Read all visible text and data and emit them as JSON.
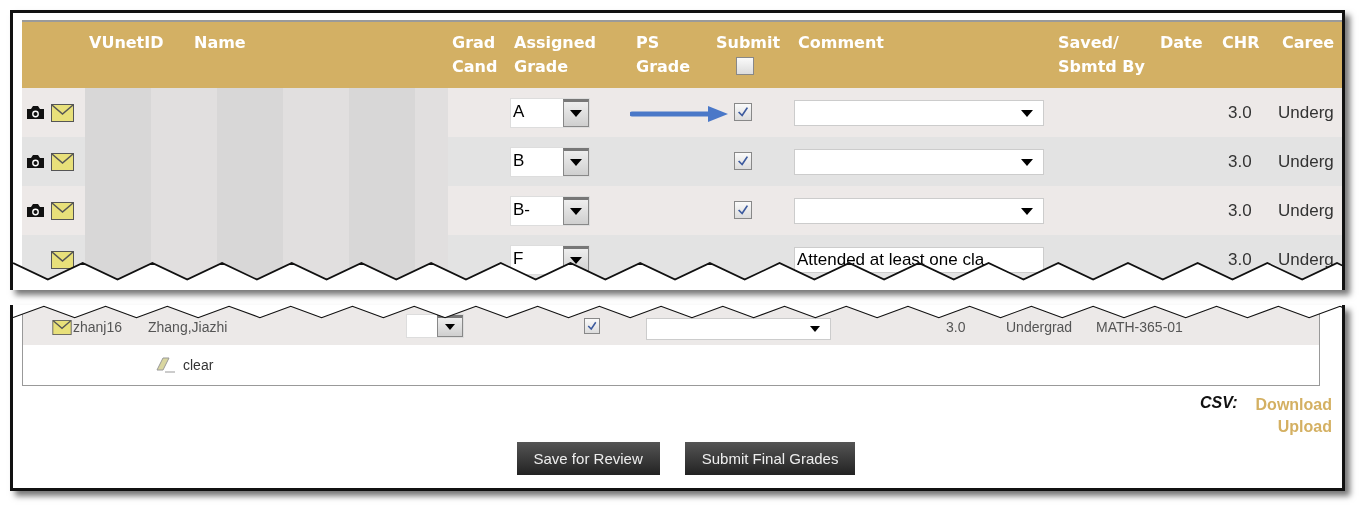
{
  "header": [
    {
      "label": "VUnetID"
    },
    {
      "label": "Name"
    },
    {
      "label": "Grad Cand"
    },
    {
      "label": "Assigned Grade"
    },
    {
      "label": "PS Grade"
    },
    {
      "label": "Submit",
      "checked": false
    },
    {
      "label": "Comment"
    },
    {
      "label": "Saved/ Sbmtd By"
    },
    {
      "label": "Date"
    },
    {
      "label": "CHR"
    },
    {
      "label": "Caree"
    }
  ],
  "rows": [
    {
      "camera": true,
      "grade": "A",
      "submit": true,
      "chr": "3.0",
      "career": "Underg",
      "arrow": true
    },
    {
      "camera": true,
      "grade": "B",
      "submit": true,
      "chr": "3.0",
      "career": "Underg",
      "arrow": false
    },
    {
      "camera": true,
      "grade": "B-",
      "submit": true,
      "chr": "3.0",
      "career": "Underg",
      "arrow": false
    },
    {
      "camera": false,
      "grade": "F",
      "comment": "Attended at least one cla",
      "chr": "3.0",
      "career": "Underg",
      "arrow": false
    }
  ],
  "continued_row": {
    "vunetid": "zhanj16",
    "name": "Zhang,Jiazhi",
    "submit": true,
    "chr": "3.0",
    "career": "Undergrad",
    "class": "MATH-365-01"
  },
  "clear": {
    "label": "clear"
  },
  "csv": {
    "label": "CSV:",
    "links": [
      "Download",
      "Upload"
    ]
  },
  "buttons": [
    "Save for Review",
    "Submit Final Grades"
  ]
}
